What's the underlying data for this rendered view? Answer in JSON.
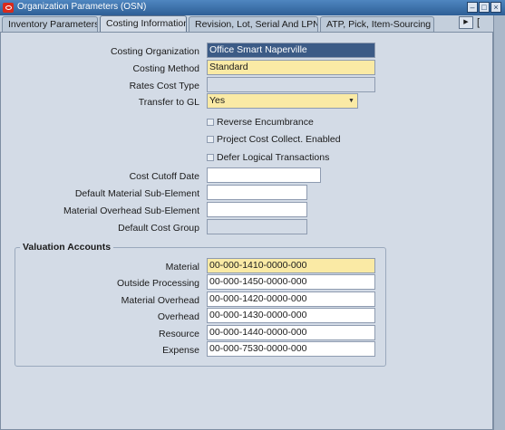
{
  "window": {
    "title": "Organization Parameters (OSN)"
  },
  "tabs": [
    {
      "label": "Inventory Parameters"
    },
    {
      "label": "Costing Information"
    },
    {
      "label": "Revision, Lot, Serial And LPN"
    },
    {
      "label": "ATP, Pick, Item-Sourcing"
    }
  ],
  "tab_overflow": "[",
  "form": {
    "costing_organization": {
      "label": "Costing Organization",
      "value": "Office Smart Naperville"
    },
    "costing_method": {
      "label": "Costing Method",
      "value": "Standard"
    },
    "rates_cost_type": {
      "label": "Rates Cost Type",
      "value": ""
    },
    "transfer_to_gl": {
      "label": "Transfer to GL",
      "value": "Yes"
    },
    "reverse_encumbrance": {
      "label": "Reverse Encumbrance",
      "checked": false
    },
    "project_cost_collect": {
      "label": "Project Cost Collect. Enabled",
      "checked": false
    },
    "defer_logical_transactions": {
      "label": "Defer Logical Transactions",
      "checked": false
    },
    "cost_cutoff_date": {
      "label": "Cost Cutoff Date",
      "value": ""
    },
    "default_material_sub_element": {
      "label": "Default Material Sub-Element",
      "value": ""
    },
    "material_overhead_sub_element": {
      "label": "Material Overhead Sub-Element",
      "value": ""
    },
    "default_cost_group": {
      "label": "Default Cost Group",
      "value": ""
    }
  },
  "valuation": {
    "title": "Valuation Accounts",
    "material": {
      "label": "Material",
      "value": "00-000-1410-0000-000"
    },
    "outside_processing": {
      "label": "Outside Processing",
      "value": "00-000-1450-0000-000"
    },
    "material_overhead": {
      "label": "Material Overhead",
      "value": "00-000-1420-0000-000"
    },
    "overhead": {
      "label": "Overhead",
      "value": "00-000-1430-0000-000"
    },
    "resource": {
      "label": "Resource",
      "value": "00-000-1440-0000-000"
    },
    "expense": {
      "label": "Expense",
      "value": "00-000-7530-0000-000"
    }
  },
  "colors": {
    "titlebar": "#2e5f96",
    "required_field": "#faeaa5",
    "panel": "#d3dbe6"
  }
}
